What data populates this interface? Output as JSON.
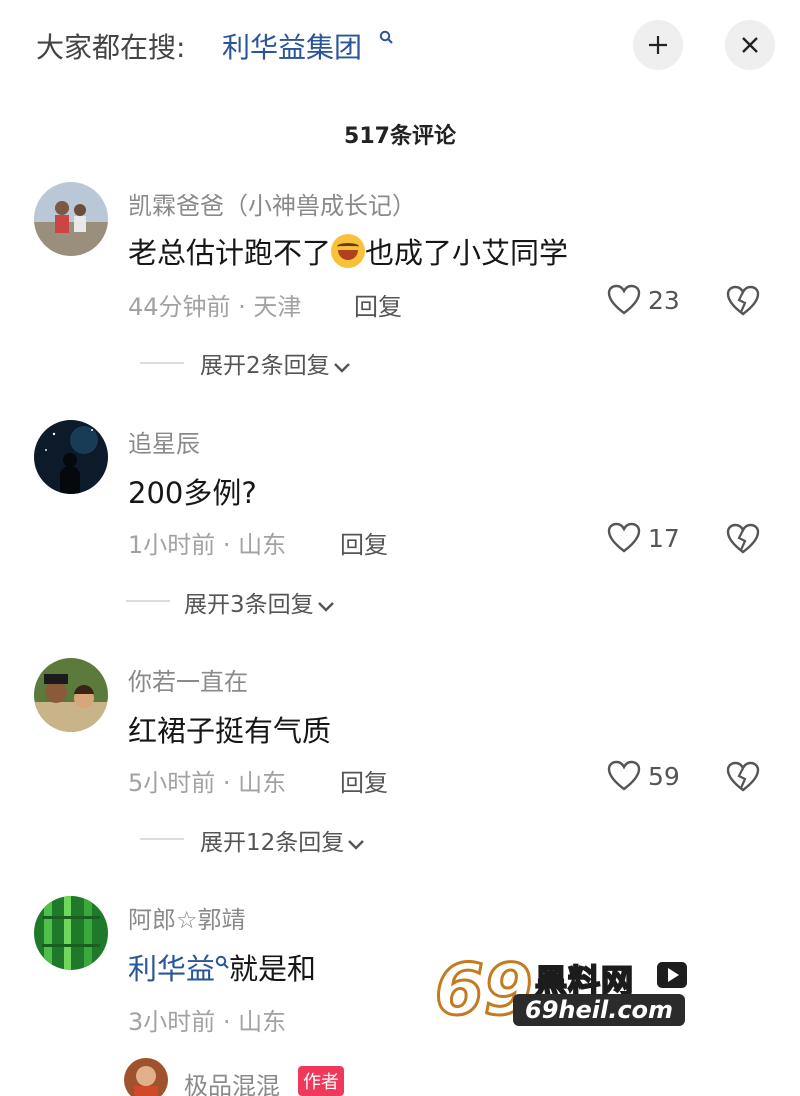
{
  "header": {
    "hot_search_label": "大家都在搜:",
    "hot_search_term": "利华益集团"
  },
  "comment_count": "517条评论",
  "comments": [
    {
      "username": "凯霖爸爸（小神兽成长记）",
      "text_before": "老总估计跑不了",
      "text_after": "也成了小艾同学",
      "emoji": "laughing-emoji",
      "meta": "44分钟前 · 天津",
      "reply": "回复",
      "likes": "23",
      "expand": "展开2条回复"
    },
    {
      "username": "追星辰",
      "text": "200多例?",
      "meta": "1小时前 · 山东",
      "reply": "回复",
      "likes": "17",
      "expand": "展开3条回复"
    },
    {
      "username": "你若一直在",
      "text": "红裙子挺有气质",
      "meta": "5小时前 · 山东",
      "reply": "回复",
      "likes": "59",
      "expand": "展开12条回复"
    },
    {
      "username": "阿郎☆郭靖",
      "text_link": "利华益",
      "text_after": "就是和",
      "meta": "3小时前 · 山东"
    },
    {
      "username": "极品混混",
      "badge": "作者"
    }
  ],
  "watermark": {
    "number": "69",
    "brand": "黑料网",
    "url": "69heil.com"
  },
  "colors": {
    "link": "#2a5599",
    "badge": "#f0385a",
    "meta": "#a2a2a2"
  }
}
